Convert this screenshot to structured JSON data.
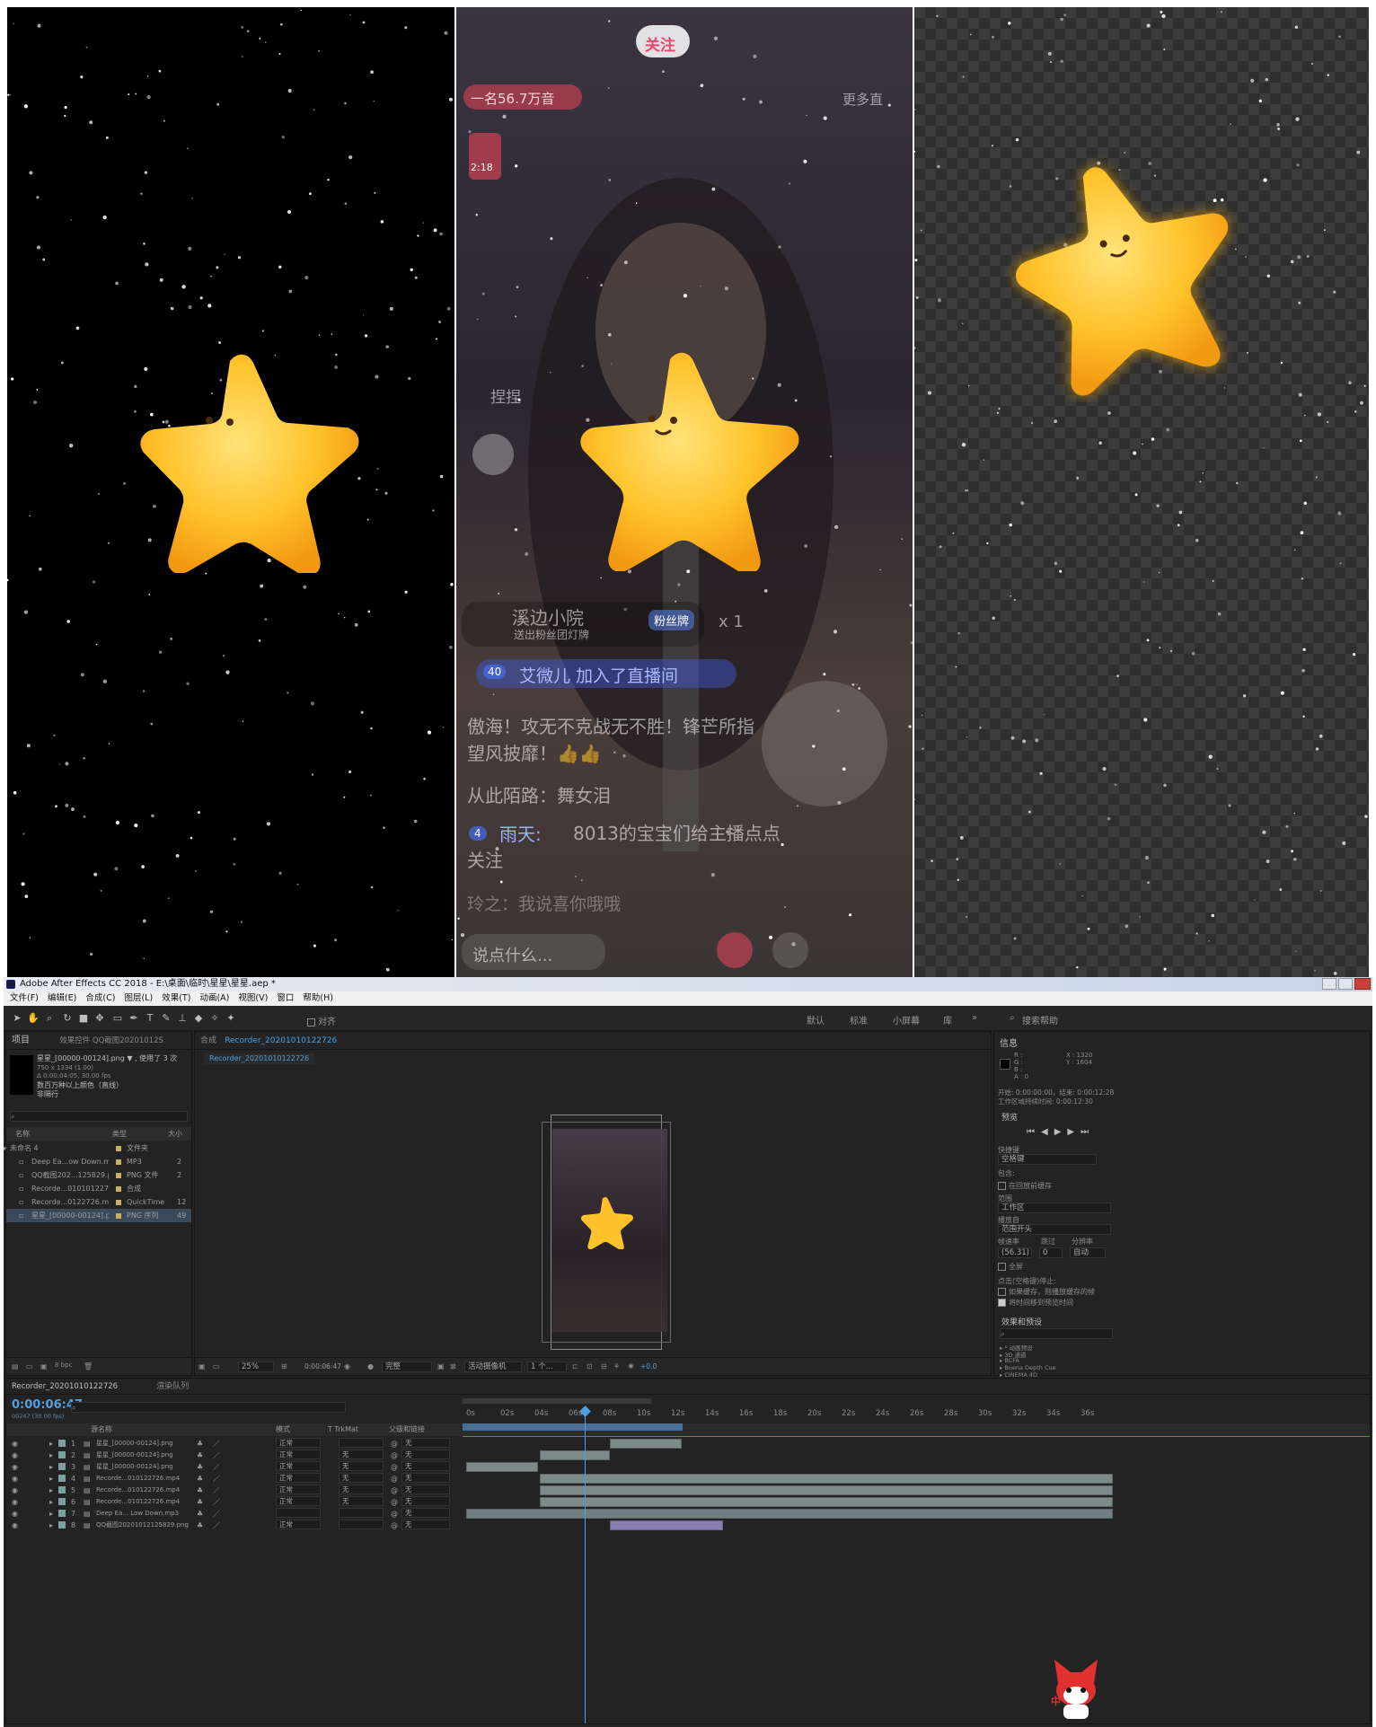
{
  "live": {
    "follow": "关注",
    "rank": "一名56.7万音",
    "more": "更多直",
    "avatar_time": "2:18",
    "name_tag": "捏捏",
    "gift_user": "溪边小院",
    "gift_sub": "送出粉丝团灯牌",
    "gift_badge": "粉丝牌",
    "gift_count": "x 1",
    "join_level": "40",
    "join_text": "艾微儿 加入了直播间",
    "chat1": "傲海！攻无不克战无不胜！锋芒所指望风披靡！👍👍",
    "chat2": "从此陌路：舞女泪",
    "chat3_level": "4",
    "chat3_user": "雨天:",
    "chat3_text": "8013的宝宝们给主播点点关注",
    "chat4": "玲之：我说喜你哦哦",
    "input": "说点什么..."
  },
  "ae": {
    "title": "Adobe After Effects CC 2018 - E:\\桌面\\临时\\星星\\星星.aep *",
    "menu": [
      "文件(F)",
      "编辑(E)",
      "合成(C)",
      "图层(L)",
      "效果(T)",
      "动画(A)",
      "视图(V)",
      "窗口",
      "帮助(H)"
    ],
    "align": "对齐",
    "workspaces": [
      "默认",
      "标准",
      "小屏幕",
      "库"
    ],
    "search_help": "搜索帮助",
    "project": {
      "tab": "项目",
      "effects_tab": "效果控件 QQ截图20201012S",
      "file_name": "星星_[00000-00124].png ▼ , 使用了 3 次",
      "file_dims": "750 x 1334 (1.00)",
      "file_dur": "Δ 0:00:04:05, 30.00 fps",
      "file_colors": "数百万种以上颜色（直线）",
      "file_interlace": "非隔行",
      "col_name": "名称",
      "col_type": "类型",
      "col_size": "大小",
      "items": [
        {
          "name": "未命名 4",
          "type": "文件夹",
          "size": ""
        },
        {
          "name": "Deep Ea...ow Down.mp3",
          "type": "MP3",
          "size": "2"
        },
        {
          "name": "QQ截图202...125829.png",
          "type": "PNG 文件",
          "size": "2"
        },
        {
          "name": "Recorde...01010122726",
          "type": "合成",
          "size": ""
        },
        {
          "name": "Recorde...0122726.mp4",
          "type": "QuickTime",
          "size": "12"
        },
        {
          "name": "星星_[00000-00124].png",
          "type": "PNG 序列",
          "size": "49"
        }
      ],
      "bpc": "8 bpc"
    },
    "comp": {
      "tab_label": "合成",
      "tab_name": "Recorder_20201010122726",
      "sub_tab": "Recorder_20201010122726",
      "zoom": "25%",
      "timecode": "0:00:06:47",
      "quality": "完整",
      "camera": "活动摄像机",
      "views": "1 个...",
      "offset": "+0.0"
    },
    "info": {
      "title": "信息",
      "r": "R :",
      "g": "G :",
      "b": "B :",
      "a": "A : 0",
      "x": "X : 1320",
      "y": "Y : 1604",
      "start": "开始: 0:00:00:00，结束: 0:00:12:28",
      "duration": "工作区域持续时间: 0:00:12:30"
    },
    "preview": {
      "title": "预览",
      "shortcut_label": "快捷键",
      "shortcut": "空格键",
      "include": "包含:",
      "cache": "在回放前缓存",
      "range_label": "范围",
      "range": "工作区",
      "playfrom_label": "播放自",
      "playfrom": "范围开头",
      "rate_label": "帧速率",
      "skip_label": "跳过",
      "res_label": "分辨率",
      "rate": "(56.31)",
      "skip": "0",
      "res": "自动",
      "fullscreen": "全屏",
      "stop_label": "点击(空格键)停止:",
      "stop1": "如果缓存，则播放缓存的帧",
      "stop2": "将时间移到预览时间"
    },
    "effects": {
      "title": "效果和预设",
      "items": [
        "* 动画预设",
        "3D 通道",
        "BCFA",
        "Buena Depth Cue",
        "CINEMA 4D",
        "Composite Wizard"
      ]
    },
    "timeline": {
      "tab": "Recorder_20201010122726",
      "render_tab": "渲染队列",
      "timecode": "0:00:06:47",
      "frames": "00247 (30.00 fps)",
      "col_source": "源名称",
      "col_mode": "模式",
      "col_track": "T TrkMat",
      "col_parent": "父级和链接",
      "ticks": [
        "0s",
        "02s",
        "04s",
        "06s",
        "08s",
        "10s",
        "12s",
        "14s",
        "16s",
        "18s",
        "20s",
        "22s",
        "24s",
        "26s",
        "28s",
        "30s",
        "32s",
        "34s",
        "36s"
      ],
      "layers": [
        {
          "num": "1",
          "name": "星星_[00000-00124].png",
          "mode": "正常",
          "trk": "",
          "parent": "无"
        },
        {
          "num": "2",
          "name": "星星_[00000-00124].png",
          "mode": "正常",
          "trk": "无",
          "parent": "无"
        },
        {
          "num": "3",
          "name": "星星_[00000-00124].png",
          "mode": "正常",
          "trk": "无",
          "parent": "无"
        },
        {
          "num": "4",
          "name": "Recorde...010122726.mp4",
          "mode": "正常",
          "trk": "无",
          "parent": "无"
        },
        {
          "num": "5",
          "name": "Recorde...010122726.mp4",
          "mode": "正常",
          "trk": "无",
          "parent": "无"
        },
        {
          "num": "6",
          "name": "Recorde...010122726.mp4",
          "mode": "正常",
          "trk": "无",
          "parent": "无"
        },
        {
          "num": "7",
          "name": "Deep Ea... Low Down.mp3",
          "mode": "",
          "trk": "",
          "parent": "无"
        },
        {
          "num": "8",
          "name": "QQ截图20201012125829.png",
          "mode": "正常",
          "trk": "",
          "parent": "无"
        }
      ]
    },
    "tray": "中"
  },
  "colors": {
    "accent": "#4fa0e0",
    "star": "#ffc22a",
    "timeline_track": "#7d8a8a",
    "ae_bg": "#232323"
  }
}
